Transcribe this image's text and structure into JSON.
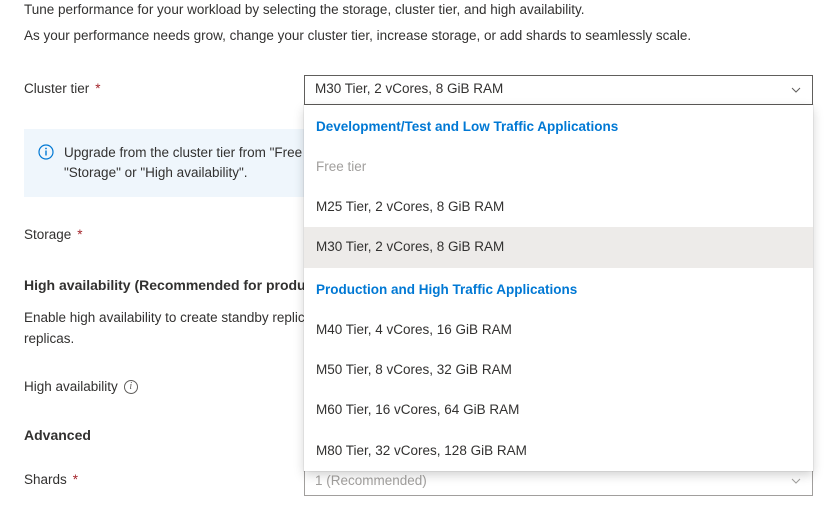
{
  "intro": {
    "line1": "Tune performance for your workload by selecting the storage, cluster tier, and high availability.",
    "line2": "As your performance needs grow, change your cluster tier, increase storage, or add shards to seamlessly scale."
  },
  "cluster_tier": {
    "label": "Cluster tier",
    "selected": "M30 Tier, 2 vCores, 8 GiB RAM"
  },
  "infobox": {
    "text": "Upgrade from the cluster tier from \"Free tier\" to one of the other options enables the selection of additional features like \"Storage\" or \"High availability\"."
  },
  "storage": {
    "label": "Storage"
  },
  "ha_section": {
    "heading": "High availability (Recommended for production workloads)",
    "desc": "Enable high availability to create standby replicas of every shard in the cluster. In case of a failure, data is preserved via standby replicas.",
    "label": "High availability"
  },
  "advanced": {
    "heading": "Advanced"
  },
  "shards": {
    "label": "Shards",
    "value": "1 (Recommended)"
  },
  "dropdown": {
    "group1_header": "Development/Test and Low Traffic Applications",
    "group1_options": [
      {
        "label": "Free tier",
        "disabled": true,
        "selected": false
      },
      {
        "label": "M25 Tier, 2 vCores, 8 GiB RAM",
        "disabled": false,
        "selected": false
      },
      {
        "label": "M30 Tier, 2 vCores, 8 GiB RAM",
        "disabled": false,
        "selected": true
      }
    ],
    "group2_header": "Production and High Traffic Applications",
    "group2_options": [
      {
        "label": "M40 Tier, 4 vCores, 16 GiB RAM"
      },
      {
        "label": "M50 Tier, 8 vCores, 32 GiB RAM"
      },
      {
        "label": "M60 Tier, 16 vCores, 64 GiB RAM"
      },
      {
        "label": "M80 Tier, 32 vCores, 128 GiB RAM"
      }
    ]
  }
}
